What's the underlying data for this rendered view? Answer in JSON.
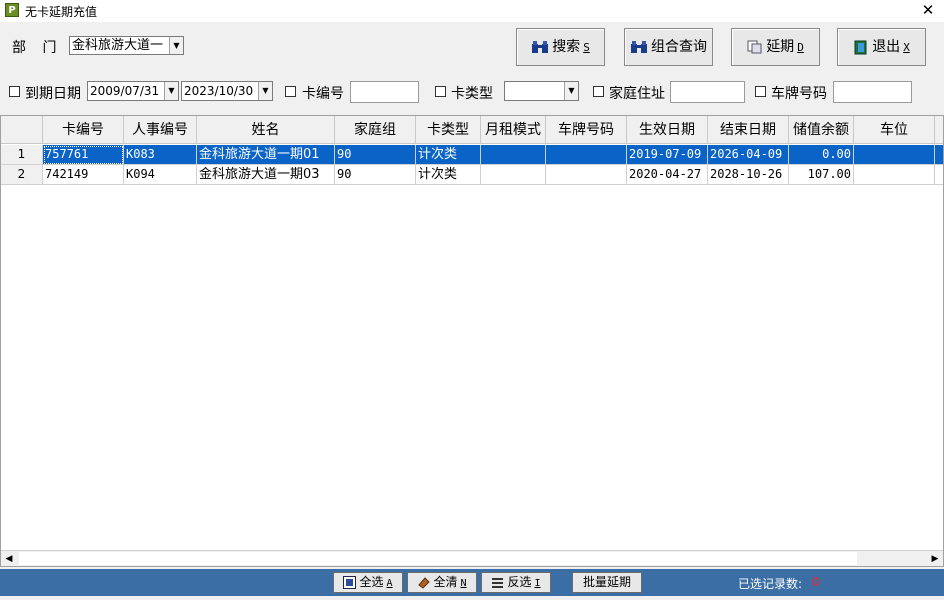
{
  "window": {
    "title": "无卡延期充值",
    "icon_letter": "P",
    "close_glyph": "✕"
  },
  "dept": {
    "label": "部 门",
    "value": "金科旅游大道一"
  },
  "toolbar": {
    "search": {
      "label": "搜索",
      "key": "S"
    },
    "combo_query": {
      "label": "组合查询"
    },
    "extend": {
      "label": "延期",
      "key": "D"
    },
    "exit": {
      "label": "退出",
      "key": "X"
    }
  },
  "filters": {
    "expire_date": {
      "label": "到期日期",
      "from": "2009/07/31",
      "to": "2023/10/30",
      "checked": false
    },
    "card_no": {
      "label": "卡编号",
      "value": "",
      "checked": false
    },
    "card_type": {
      "label": "卡类型",
      "value": "",
      "checked": false
    },
    "address": {
      "label": "家庭住址",
      "value": "",
      "checked": false
    },
    "plate_no": {
      "label": "车牌号码",
      "value": "",
      "checked": false
    }
  },
  "table": {
    "columns": [
      "卡编号",
      "人事编号",
      "姓名",
      "家庭组",
      "卡类型",
      "月租模式",
      "车牌号码",
      "生效日期",
      "结束日期",
      "储值余额",
      "车位"
    ],
    "rows": [
      {
        "n": "1",
        "card_no": "757761",
        "emp_no": "K083",
        "name": "金科旅游大道一期01",
        "group": "90",
        "card_type": "计次类",
        "rent_mode": "",
        "plate": "",
        "start": "2019-07-09",
        "end": "2026-04-09",
        "balance": "0.00",
        "space": "",
        "selected": true
      },
      {
        "n": "2",
        "card_no": "742149",
        "emp_no": "K094",
        "name": "金科旅游大道一期03",
        "group": "90",
        "card_type": "计次类",
        "rent_mode": "",
        "plate": "",
        "start": "2020-04-27",
        "end": "2028-10-26",
        "balance": "107.00",
        "space": "",
        "selected": false
      }
    ]
  },
  "bottom": {
    "select_all": {
      "label": "全选",
      "key": "A"
    },
    "clear_all": {
      "label": "全清",
      "key": "N"
    },
    "invert": {
      "label": "反选",
      "key": "I"
    },
    "batch_extend": {
      "label": "批量延期"
    },
    "selected_count_label": "已选记录数:",
    "selected_count": "0"
  },
  "colors": {
    "selection": "#0a64c8",
    "bottom_bar": "#3a6ea5",
    "count": "#ff2020"
  }
}
